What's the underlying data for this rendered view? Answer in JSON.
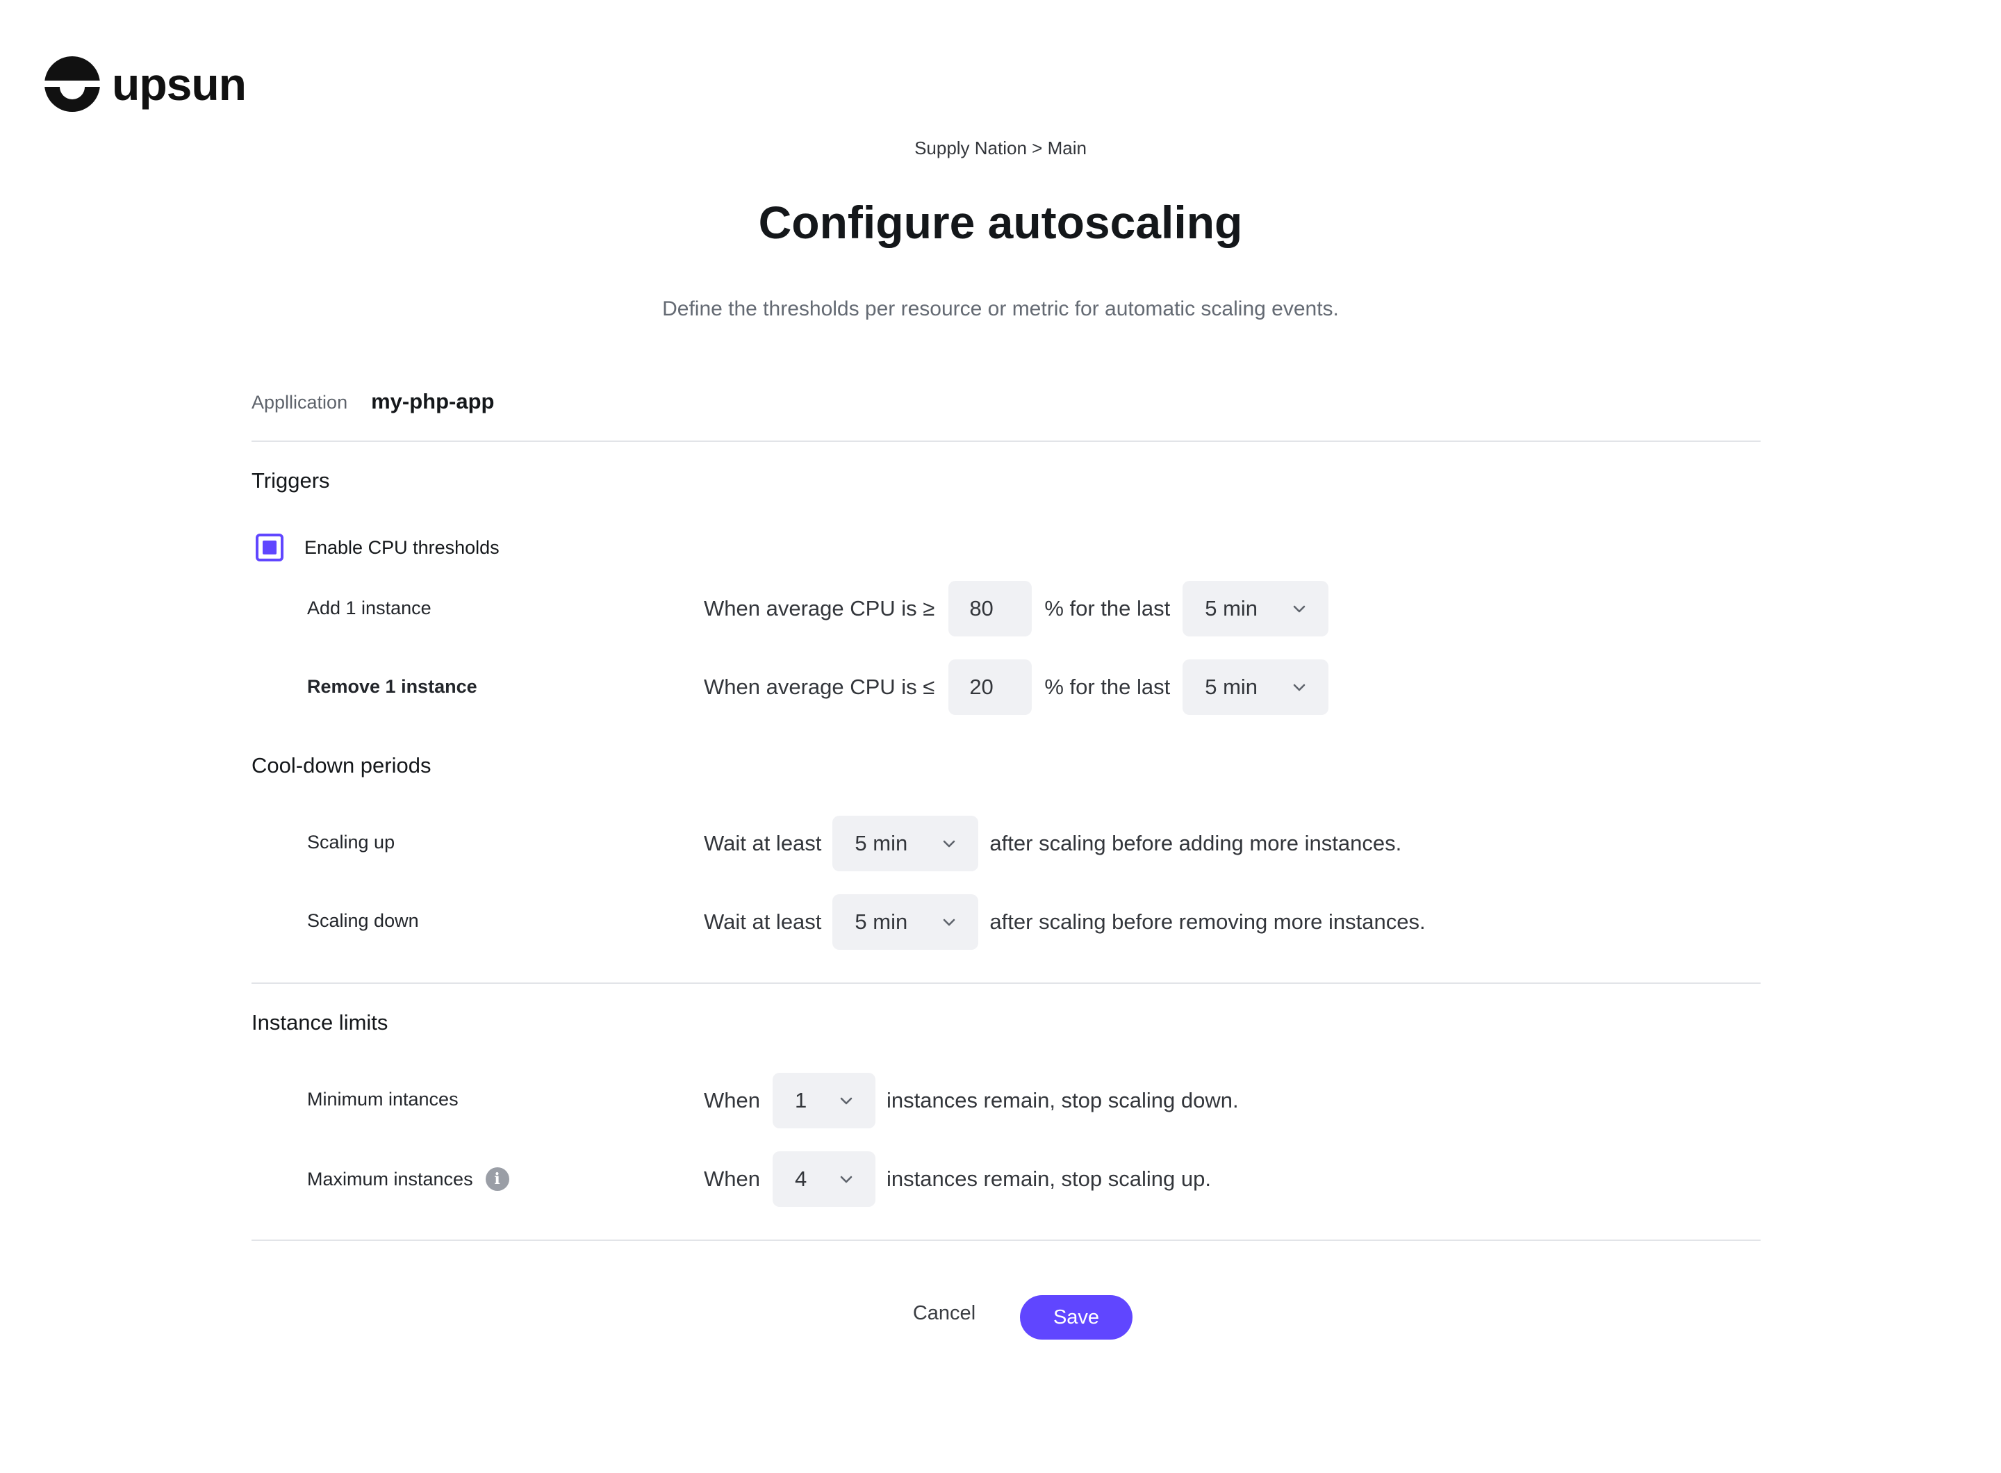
{
  "brand": {
    "name": "upsun",
    "accent": "#6046ff"
  },
  "breadcrumb": "Supply Nation > Main",
  "title": "Configure autoscaling",
  "subtitle": "Define the thresholds per resource or metric for automatic scaling events.",
  "application": {
    "label": "Appllication",
    "value": "my-php-app"
  },
  "triggers": {
    "title": "Triggers",
    "enable_cpu": {
      "label": "Enable CPU thresholds",
      "checked": true
    },
    "add": {
      "label": "Add 1 instance",
      "prefix": "When average CPU is ≥",
      "value": "80",
      "middle": "% for the last",
      "duration": "5 min"
    },
    "remove": {
      "label": "Remove 1 instance",
      "prefix": "When average CPU is ≤",
      "value": "20",
      "middle": "% for the last",
      "duration": "5 min"
    }
  },
  "cooldown": {
    "title": "Cool-down periods",
    "up": {
      "label": "Scaling up",
      "prefix": "Wait at least",
      "duration": "5 min",
      "suffix": "after scaling before adding more instances."
    },
    "down": {
      "label": "Scaling down",
      "prefix": "Wait at least",
      "duration": "5 min",
      "suffix": "after scaling before removing more instances."
    }
  },
  "limits": {
    "title": "Instance limits",
    "min": {
      "label": "Minimum intances",
      "prefix": "When",
      "value": "1",
      "suffix": "instances remain, stop scaling down."
    },
    "max": {
      "label": "Maximum instances",
      "info_icon": "i",
      "prefix": "When",
      "value": "4",
      "suffix": "instances remain, stop scaling up."
    }
  },
  "actions": {
    "cancel": "Cancel",
    "save": "Save"
  }
}
